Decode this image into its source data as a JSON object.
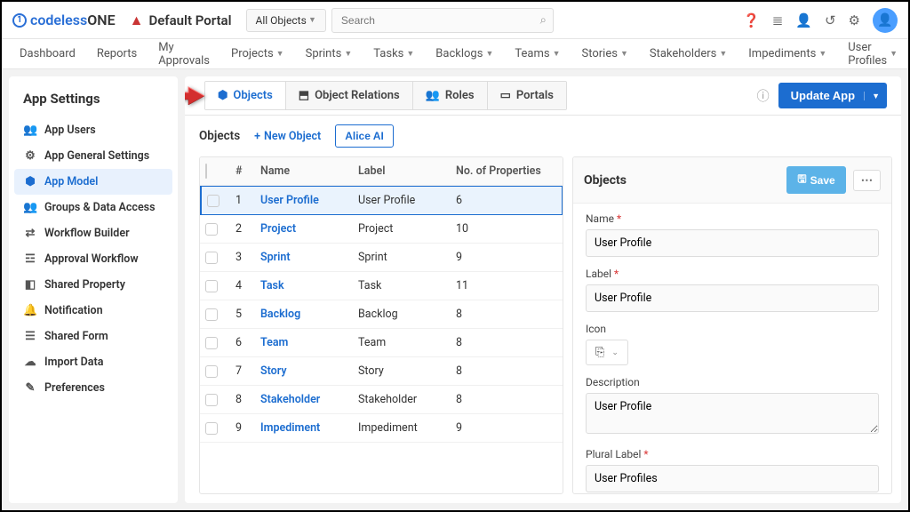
{
  "header": {
    "brand_prefix": "codeless",
    "brand_suffix": "ONE",
    "portal_name": "Default Portal",
    "object_select": "All Objects",
    "search_placeholder": "Search"
  },
  "nav": [
    "Dashboard",
    "Reports",
    "My Approvals",
    "Projects",
    "Sprints",
    "Tasks",
    "Backlogs",
    "Teams",
    "Stories",
    "Stakeholders",
    "Impediments",
    "User Profiles"
  ],
  "nav_has_caret": [
    false,
    false,
    false,
    true,
    true,
    true,
    true,
    true,
    true,
    true,
    true,
    true
  ],
  "sidebar": {
    "title": "App Settings",
    "items": [
      {
        "icon": "👥",
        "label": "App Users"
      },
      {
        "icon": "⚙",
        "label": "App General Settings"
      },
      {
        "icon": "⬢",
        "label": "App Model"
      },
      {
        "icon": "👥",
        "label": "Groups & Data Access"
      },
      {
        "icon": "⇄",
        "label": "Workflow Builder"
      },
      {
        "icon": "☲",
        "label": "Approval Workflow"
      },
      {
        "icon": "◧",
        "label": "Shared Property"
      },
      {
        "icon": "🔔",
        "label": "Notification"
      },
      {
        "icon": "☰",
        "label": "Shared Form"
      },
      {
        "icon": "☁",
        "label": "Import Data"
      },
      {
        "icon": "✎",
        "label": "Preferences"
      }
    ],
    "active_index": 2
  },
  "tabs": {
    "items": [
      {
        "icon": "⬢",
        "label": "Objects"
      },
      {
        "icon": "⬒",
        "label": "Object Relations"
      },
      {
        "icon": "👥",
        "label": "Roles"
      },
      {
        "icon": "▭",
        "label": "Portals"
      }
    ],
    "active_index": 0,
    "update_label": "Update App"
  },
  "subhead": {
    "title": "Objects",
    "new_label": "New Object",
    "alice_label": "Alice AI"
  },
  "table": {
    "headers": [
      "#",
      "Name",
      "Label",
      "No. of Properties"
    ],
    "rows": [
      {
        "n": "1",
        "name": "User Profile",
        "label": "User Profile",
        "props": "6"
      },
      {
        "n": "2",
        "name": "Project",
        "label": "Project",
        "props": "10"
      },
      {
        "n": "3",
        "name": "Sprint",
        "label": "Sprint",
        "props": "9"
      },
      {
        "n": "4",
        "name": "Task",
        "label": "Task",
        "props": "11"
      },
      {
        "n": "5",
        "name": "Backlog",
        "label": "Backlog",
        "props": "8"
      },
      {
        "n": "6",
        "name": "Team",
        "label": "Team",
        "props": "8"
      },
      {
        "n": "7",
        "name": "Story",
        "label": "Story",
        "props": "8"
      },
      {
        "n": "8",
        "name": "Stakeholder",
        "label": "Stakeholder",
        "props": "8"
      },
      {
        "n": "9",
        "name": "Impediment",
        "label": "Impediment",
        "props": "9"
      }
    ],
    "selected_index": 0
  },
  "detail": {
    "title": "Objects",
    "save_label": "Save",
    "fields": {
      "name_label": "Name",
      "name_value": "User Profile",
      "label_label": "Label",
      "label_value": "User Profile",
      "icon_label": "Icon",
      "desc_label": "Description",
      "desc_value": "User Profile",
      "plural_label": "Plural Label",
      "plural_value": "User Profiles"
    }
  }
}
